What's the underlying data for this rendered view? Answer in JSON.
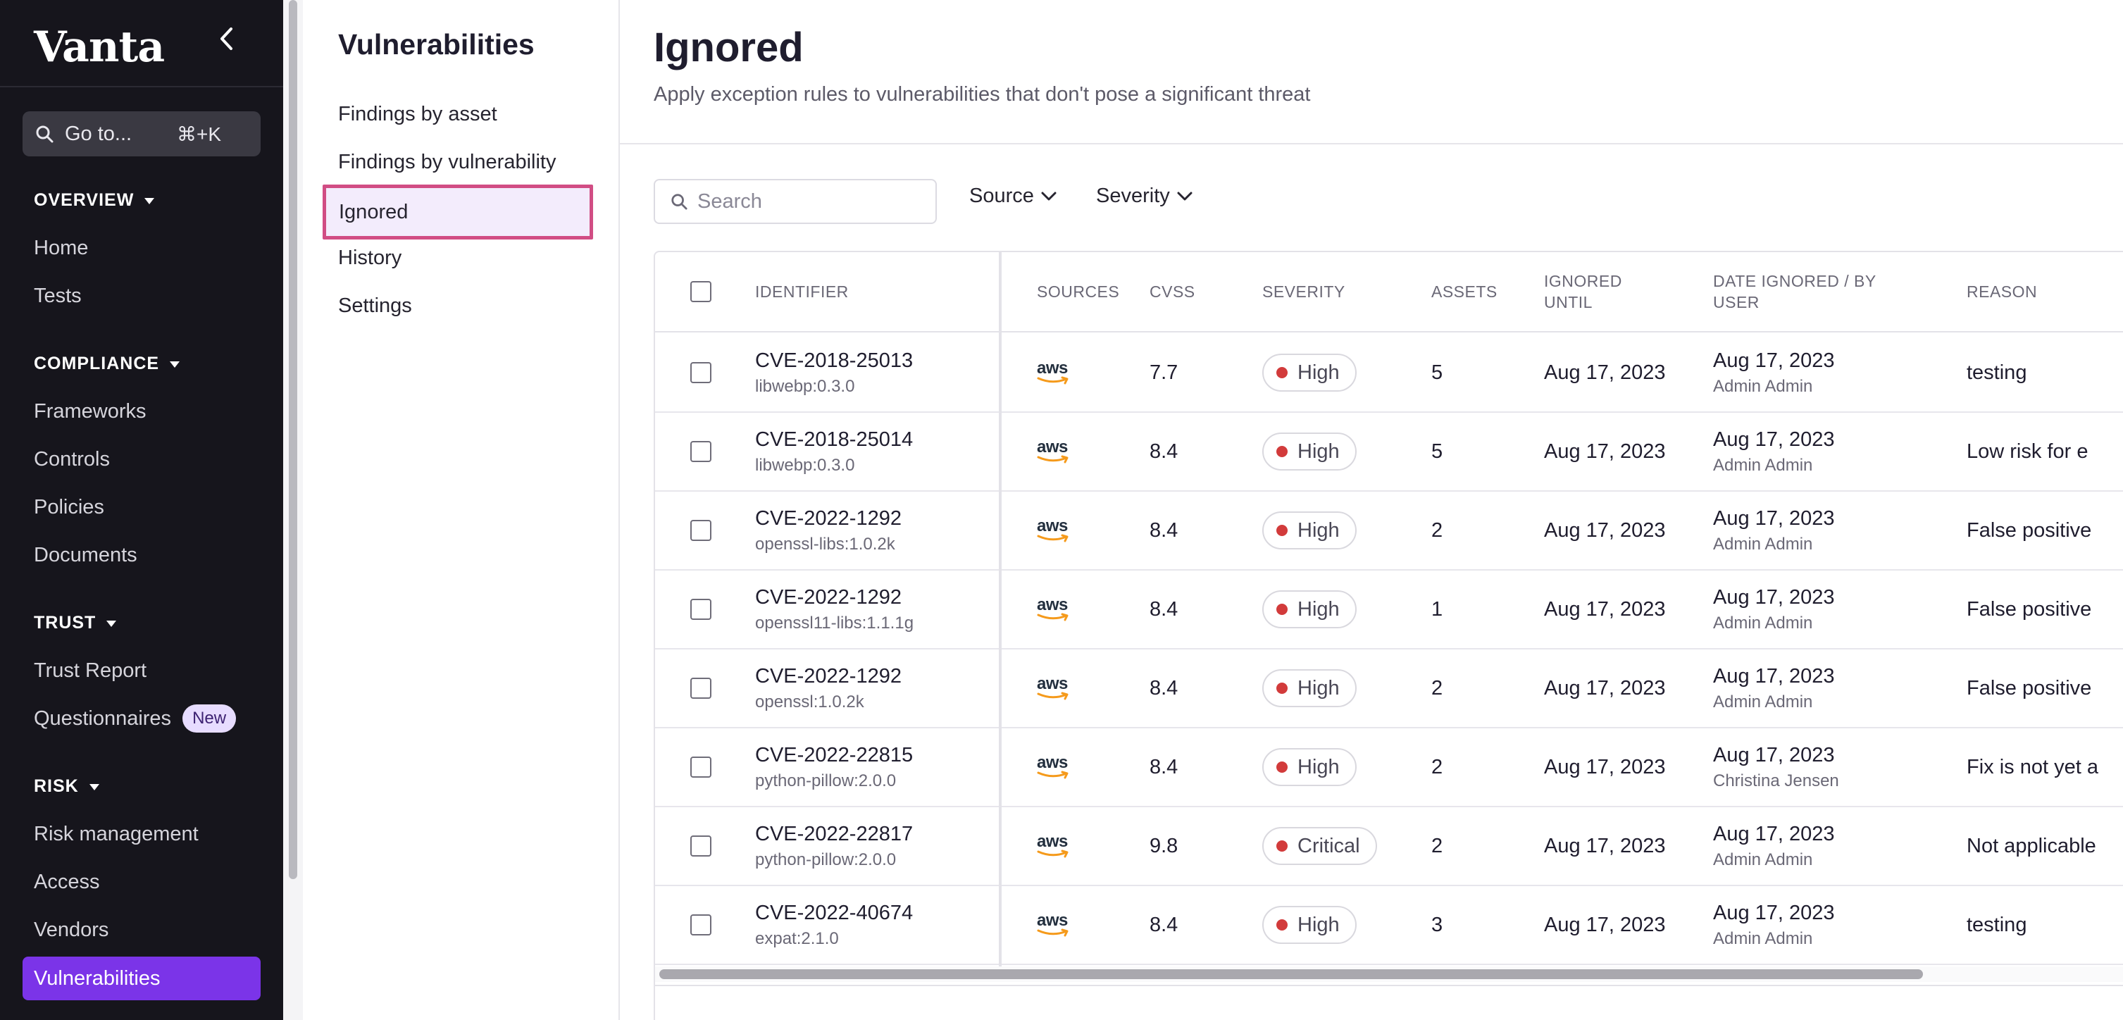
{
  "brand": {
    "logo": "Vanta",
    "accent": "#7b34e8",
    "active_outline": "#d14d84"
  },
  "goto": {
    "label": "Go to...",
    "shortcut": "⌘+K"
  },
  "sidebar": {
    "sections": [
      {
        "title": "OVERVIEW",
        "items": [
          "Home",
          "Tests"
        ]
      },
      {
        "title": "COMPLIANCE",
        "items": [
          "Frameworks",
          "Controls",
          "Policies",
          "Documents"
        ]
      },
      {
        "title": "TRUST",
        "items": [
          "Trust Report",
          "Questionnaires"
        ]
      },
      {
        "title": "RISK",
        "items": [
          "Risk management",
          "Access",
          "Vendors",
          "Vulnerabilities"
        ]
      }
    ],
    "new_badge": "New",
    "active_item": "Vulnerabilities"
  },
  "subnav": {
    "title": "Vulnerabilities",
    "items": [
      "Findings by asset",
      "Findings by vulnerability",
      "Ignored",
      "History",
      "Settings"
    ],
    "active": "Ignored"
  },
  "page": {
    "title": "Ignored",
    "subtitle": "Apply exception rules to vulnerabilities that don't pose a significant threat"
  },
  "toolbar": {
    "search_placeholder": "Search",
    "filters": [
      "Source",
      "Severity"
    ]
  },
  "table": {
    "columns": [
      "IDENTIFIER",
      "SOURCES",
      "CVSS",
      "SEVERITY",
      "ASSETS",
      "IGNORED UNTIL",
      "DATE IGNORED / BY USER",
      "REASON"
    ],
    "rows": [
      {
        "id": "CVE-2018-25013",
        "package": "libwebp:0.3.0",
        "source": "aws",
        "cvss": "7.7",
        "severity": "High",
        "assets": "5",
        "ignored_until": "Aug 17, 2023",
        "date_ignored": "Aug 17, 2023",
        "user": "Admin Admin",
        "reason": "testing"
      },
      {
        "id": "CVE-2018-25014",
        "package": "libwebp:0.3.0",
        "source": "aws",
        "cvss": "8.4",
        "severity": "High",
        "assets": "5",
        "ignored_until": "Aug 17, 2023",
        "date_ignored": "Aug 17, 2023",
        "user": "Admin Admin",
        "reason": "Low risk for e"
      },
      {
        "id": "CVE-2022-1292",
        "package": "openssl-libs:1.0.2k",
        "source": "aws",
        "cvss": "8.4",
        "severity": "High",
        "assets": "2",
        "ignored_until": "Aug 17, 2023",
        "date_ignored": "Aug 17, 2023",
        "user": "Admin Admin",
        "reason": "False positive"
      },
      {
        "id": "CVE-2022-1292",
        "package": "openssl11-libs:1.1.1g",
        "source": "aws",
        "cvss": "8.4",
        "severity": "High",
        "assets": "1",
        "ignored_until": "Aug 17, 2023",
        "date_ignored": "Aug 17, 2023",
        "user": "Admin Admin",
        "reason": "False positive"
      },
      {
        "id": "CVE-2022-1292",
        "package": "openssl:1.0.2k",
        "source": "aws",
        "cvss": "8.4",
        "severity": "High",
        "assets": "2",
        "ignored_until": "Aug 17, 2023",
        "date_ignored": "Aug 17, 2023",
        "user": "Admin Admin",
        "reason": "False positive"
      },
      {
        "id": "CVE-2022-22815",
        "package": "python-pillow:2.0.0",
        "source": "aws",
        "cvss": "8.4",
        "severity": "High",
        "assets": "2",
        "ignored_until": "Aug 17, 2023",
        "date_ignored": "Aug 17, 2023",
        "user": "Christina Jensen",
        "reason": "Fix is not yet a"
      },
      {
        "id": "CVE-2022-22817",
        "package": "python-pillow:2.0.0",
        "source": "aws",
        "cvss": "9.8",
        "severity": "Critical",
        "assets": "2",
        "ignored_until": "Aug 17, 2023",
        "date_ignored": "Aug 17, 2023",
        "user": "Admin Admin",
        "reason": "Not applicable"
      },
      {
        "id": "CVE-2022-40674",
        "package": "expat:2.1.0",
        "source": "aws",
        "cvss": "8.4",
        "severity": "High",
        "assets": "3",
        "ignored_until": "Aug 17, 2023",
        "date_ignored": "Aug 17, 2023",
        "user": "Admin Admin",
        "reason": "testing"
      }
    ]
  }
}
